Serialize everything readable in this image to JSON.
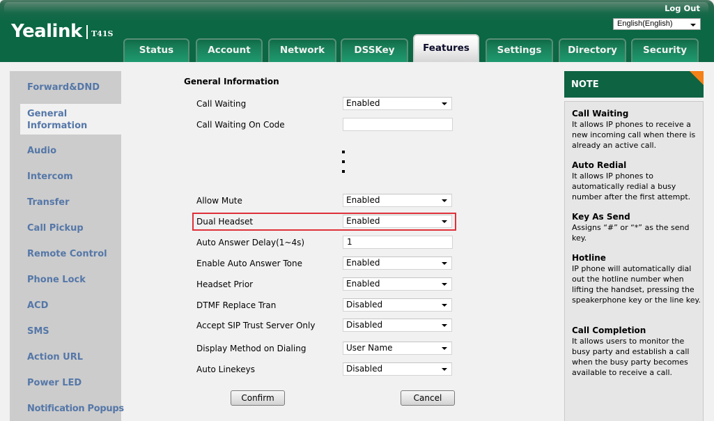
{
  "header": {
    "brand": "Yealink",
    "model": "T41S",
    "logout_label": "Log Out",
    "language": "English(English)"
  },
  "tabs": [
    {
      "label": "Status",
      "active": false
    },
    {
      "label": "Account",
      "active": false
    },
    {
      "label": "Network",
      "active": false
    },
    {
      "label": "DSSKey",
      "active": false
    },
    {
      "label": "Features",
      "active": true
    },
    {
      "label": "Settings",
      "active": false
    },
    {
      "label": "Directory",
      "active": false
    },
    {
      "label": "Security",
      "active": false
    }
  ],
  "sidebar": {
    "items": [
      {
        "label": "Forward&DND"
      },
      {
        "label": "General Information",
        "active": true
      },
      {
        "label": "Audio"
      },
      {
        "label": "Intercom"
      },
      {
        "label": "Transfer"
      },
      {
        "label": "Call Pickup"
      },
      {
        "label": "Remote Control"
      },
      {
        "label": "Phone Lock"
      },
      {
        "label": "ACD"
      },
      {
        "label": "SMS"
      },
      {
        "label": "Action URL"
      },
      {
        "label": "Power LED"
      },
      {
        "label": "Notification Popups"
      }
    ]
  },
  "form": {
    "section_title": "General Information",
    "fields": [
      {
        "label": "Call Waiting",
        "type": "select",
        "value": "Enabled"
      },
      {
        "label": "Call Waiting On Code",
        "type": "input",
        "value": ""
      },
      {
        "label": "Allow Mute",
        "type": "select",
        "value": "Enabled"
      },
      {
        "label": "Dual Headset",
        "type": "select",
        "value": "Enabled",
        "highlighted": true
      },
      {
        "label": "Auto Answer Delay(1~4s)",
        "type": "input",
        "value": "1"
      },
      {
        "label": "Enable Auto Answer Tone",
        "type": "select",
        "value": "Enabled"
      },
      {
        "label": "Headset Prior",
        "type": "select",
        "value": "Enabled"
      },
      {
        "label": "DTMF Replace Tran",
        "type": "select",
        "value": "Disabled"
      },
      {
        "label": "Accept SIP Trust Server Only",
        "type": "select",
        "value": "Disabled"
      },
      {
        "label": "Display Method on Dialing",
        "type": "select",
        "value": "User Name"
      },
      {
        "label": "Auto Linekeys",
        "type": "select",
        "value": "Disabled"
      }
    ],
    "confirm_label": "Confirm",
    "cancel_label": "Cancel"
  },
  "note": {
    "title": "NOTE",
    "items": [
      {
        "title": "Call Waiting",
        "desc": "It allows IP phones to receive a new incoming call when there is already an active call."
      },
      {
        "title": "Auto Redial",
        "desc": "It allows IP phones to automatically redial a busy number after the first attempt."
      },
      {
        "title": "Key As Send",
        "desc": "Assigns “#” or “*” as the send key."
      },
      {
        "title": "Hotline",
        "desc": "IP phone will automatically dial out the hotline number when lifting the handset, pressing the speakerphone key or the line key."
      },
      {
        "title": "Call Completion",
        "desc": "It allows users to monitor the busy party and establish a call when the busy party becomes available to receive a call."
      }
    ]
  },
  "colors": {
    "brand_green": "#0b6744",
    "sidebar_link": "#5577a8",
    "highlight_red": "#e0303a",
    "note_corner": "#f48018"
  }
}
